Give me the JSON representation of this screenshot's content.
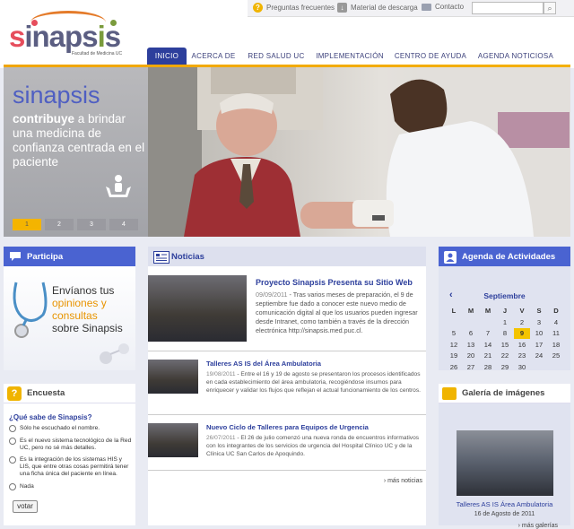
{
  "header": {
    "logo_text": "sinapsis",
    "logo_tagline": "Facultad de Medicina UC",
    "util_links": {
      "faq": "Preguntas frecuentes",
      "downloads": "Material de descarga",
      "contact": "Contacto"
    },
    "search": {
      "value": "",
      "placeholder": ""
    }
  },
  "nav": {
    "items": [
      {
        "label": "INICIO",
        "active": true
      },
      {
        "label": "ACERCA DE"
      },
      {
        "label": "RED SALUD UC"
      },
      {
        "label": "IMPLEMENTACIÓN"
      },
      {
        "label": "CENTRO DE AYUDA"
      },
      {
        "label": "AGENDA NOTICIOSA"
      }
    ]
  },
  "hero": {
    "brand": "sinapsis",
    "text_bold": "contribuye",
    "text_rest": " a brindar una medicina de confianza centrada en el paciente",
    "pages": [
      "1",
      "2",
      "3",
      "4"
    ],
    "active_page": 1
  },
  "participa": {
    "title": "Participa",
    "line1": "Envíanos tus",
    "highlight": "opiniones y consultas",
    "line3": "sobre Sinapsis"
  },
  "encuesta": {
    "title": "Encuesta",
    "question": "¿Qué sabe de Sinapsis?",
    "options": [
      "Sólo he escuchado el nombre.",
      "Es el nuevo sistema tecnológico de la Red UC, pero no sé más detalles.",
      "Es la integración de los sistemas HIS y LIS, que entre otras cosas permitirá tener una ficha única del paciente en línea.",
      "Nada"
    ],
    "vote_label": "votar"
  },
  "noticias": {
    "title": "Noticias",
    "items": [
      {
        "title": "Proyecto Sinapsis Presenta su Sitio Web",
        "date": "09/09/2011",
        "body": " - Tras varios meses de preparación, el 9 de septiembre fue dado a conocer este nuevo medio de comunicación digital al que los usuarios pueden ingresar desde Intranet, como también a través de la dirección electrónica http://sinapsis.med.puc.cl."
      },
      {
        "title": "Talleres AS IS del Área Ambulatoria",
        "date": "19/08/2011",
        "body": " - Entre el 16 y 19 de agosto se presentaron los procesos identificados en cada establecimiento del área ambulatoria, recogiéndose insumos para enriquecer y validar los flujos que reflejan el actual funcionamiento de los centros."
      },
      {
        "title": "Nuevo Ciclo de Talleres para Equipos de Urgencia",
        "date": "26/07/2011",
        "body": " - El 26 de julio comenzó una nueva ronda de encuentros informativos con los integrantes de los servicios de urgencia del Hospital Clínico UC y de la Clínica UC San Carlos de Apoquindo."
      }
    ],
    "more": "› más noticias"
  },
  "agenda": {
    "title": "Agenda de Actividades",
    "month": "Septiembre",
    "weekdays": [
      "L",
      "M",
      "M",
      "J",
      "V",
      "S",
      "D"
    ],
    "weeks": [
      [
        "",
        "",
        "",
        "1",
        "2",
        "3",
        "4"
      ],
      [
        "5",
        "6",
        "7",
        "8",
        "9",
        "10",
        "11"
      ],
      [
        "12",
        "13",
        "14",
        "15",
        "16",
        "17",
        "18"
      ],
      [
        "19",
        "20",
        "21",
        "22",
        "23",
        "24",
        "25"
      ],
      [
        "26",
        "27",
        "28",
        "29",
        "30",
        "",
        ""
      ]
    ],
    "today": "9"
  },
  "galeria": {
    "title": "Galería de imágenes",
    "caption": "Talleres AS IS Área Ambulatoria",
    "date": "16 de Agosto de 2011",
    "more": "› más galerías"
  },
  "colors": {
    "nav_active": "#2d3f9c",
    "box_header": "#4a63d1",
    "accent_orange": "#f0a500",
    "logo_red": "#e64d5c",
    "logo_green": "#7a9b3c"
  }
}
